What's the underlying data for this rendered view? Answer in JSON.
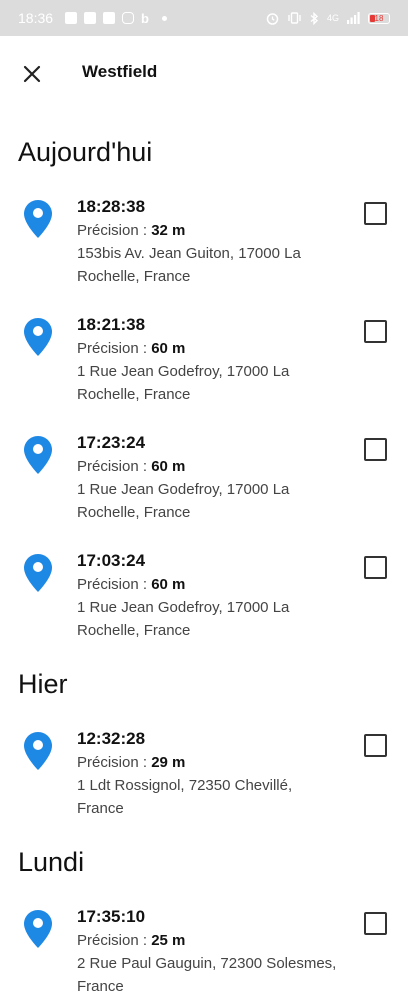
{
  "status_bar": {
    "time": "18:36",
    "network": "4G",
    "battery_level": "18",
    "colors": {
      "battery_low": "#e53935"
    }
  },
  "app_bar": {
    "title": "Westfield",
    "close_icon": "close-icon"
  },
  "accent_color": "#1e88e5",
  "precision_label": "Précision : ",
  "sections": [
    {
      "title": "Aujourd'hui",
      "entries": [
        {
          "time": "18:28:38",
          "precision": "32 m",
          "address": "153bis Av. Jean Guiton, 17000 La Rochelle, France"
        },
        {
          "time": "18:21:38",
          "precision": "60 m",
          "address": "1 Rue Jean Godefroy, 17000 La Rochelle, France"
        },
        {
          "time": "17:23:24",
          "precision": "60 m",
          "address": "1 Rue Jean Godefroy, 17000 La Rochelle, France"
        },
        {
          "time": "17:03:24",
          "precision": "60 m",
          "address": "1 Rue Jean Godefroy, 17000 La Rochelle, France"
        }
      ]
    },
    {
      "title": "Hier",
      "entries": [
        {
          "time": "12:32:28",
          "precision": "29 m",
          "address": "1 Ldt Rossignol, 72350 Chevillé, France"
        }
      ]
    },
    {
      "title": "Lundi",
      "entries": [
        {
          "time": "17:35:10",
          "precision": "25 m",
          "address": "2 Rue Paul Gauguin, 72300 Solesmes, France"
        }
      ]
    }
  ]
}
